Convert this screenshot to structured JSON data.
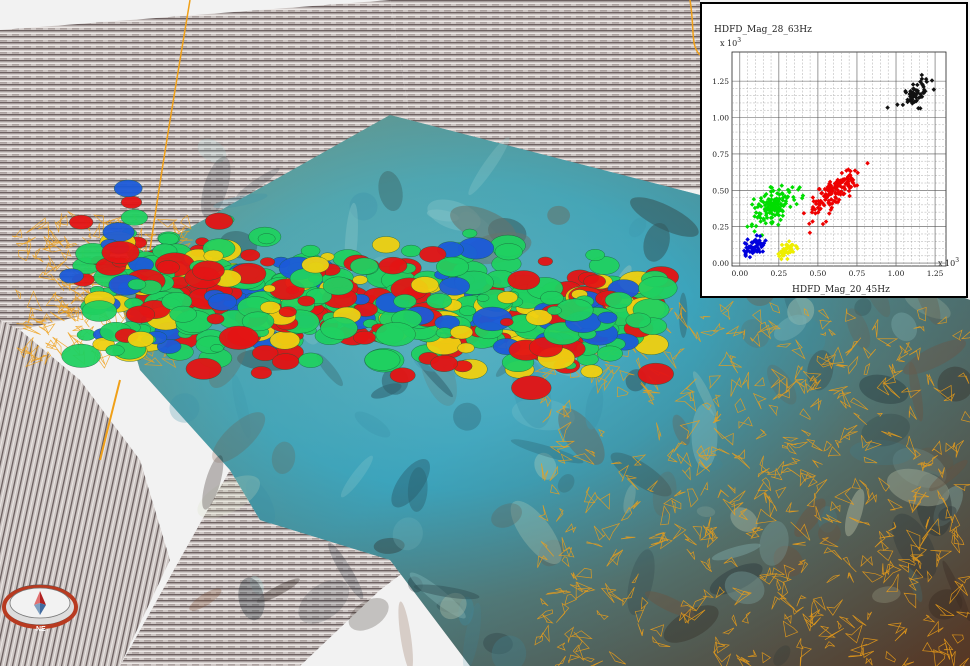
{
  "scene": {
    "description_colors": {
      "background": "#f2f2f2",
      "seismic_light": "#d8d2d0",
      "seismic_dark": "#5b5050",
      "fault_line": "#f0a018",
      "body_red": "#e41414",
      "body_green": "#20d060",
      "body_yellow": "#f0d010",
      "body_blue": "#1c5ad8",
      "map_cyan": "#40b8c8",
      "map_brown": "#5a3a28"
    }
  },
  "compass": {
    "label": "NE",
    "icon": "compass-icon"
  },
  "chart_data": {
    "type": "scatter",
    "title": "HDFD_Mag_28_63Hz",
    "xlabel": "HDFD_Mag_20_45Hz",
    "ylabel": "",
    "x_multiplier": "x 10",
    "x_multiplier_exp": "3",
    "y_multiplier": "x 10",
    "y_multiplier_exp": "3",
    "xlim": [
      -0.05,
      1.32
    ],
    "ylim": [
      -0.02,
      1.45
    ],
    "x_ticks": [
      "0.00",
      "0.25",
      "0.50",
      "0.75",
      "1.00",
      "1.25"
    ],
    "y_ticks": [
      "0.00",
      "0.25",
      "0.50",
      "0.75",
      "1.00",
      "1.25"
    ],
    "grid": true,
    "series": [
      {
        "color": "#00dd00",
        "marker": "diamond",
        "cluster": {
          "cx": 0.22,
          "cy": 0.4,
          "sx": 0.065,
          "sy": 0.06,
          "slope": 0.55,
          "n": 150
        }
      },
      {
        "color": "#ee0000",
        "marker": "diamond",
        "cluster": {
          "cx": 0.6,
          "cy": 0.48,
          "sx": 0.08,
          "sy": 0.05,
          "slope": 0.85,
          "n": 140
        }
      },
      {
        "color": "#0000dd",
        "marker": "diamond",
        "cluster": {
          "cx": 0.09,
          "cy": 0.11,
          "sx": 0.035,
          "sy": 0.03,
          "slope": 0.45,
          "n": 55
        }
      },
      {
        "color": "#eeee00",
        "marker": "diamond",
        "cluster": {
          "cx": 0.3,
          "cy": 0.08,
          "sx": 0.03,
          "sy": 0.025,
          "slope": 0.4,
          "n": 40
        }
      },
      {
        "color": "#111111",
        "marker": "diamond",
        "cluster": {
          "cx": 1.12,
          "cy": 1.17,
          "sx": 0.05,
          "sy": 0.04,
          "slope": 0.75,
          "n": 60
        }
      }
    ]
  }
}
